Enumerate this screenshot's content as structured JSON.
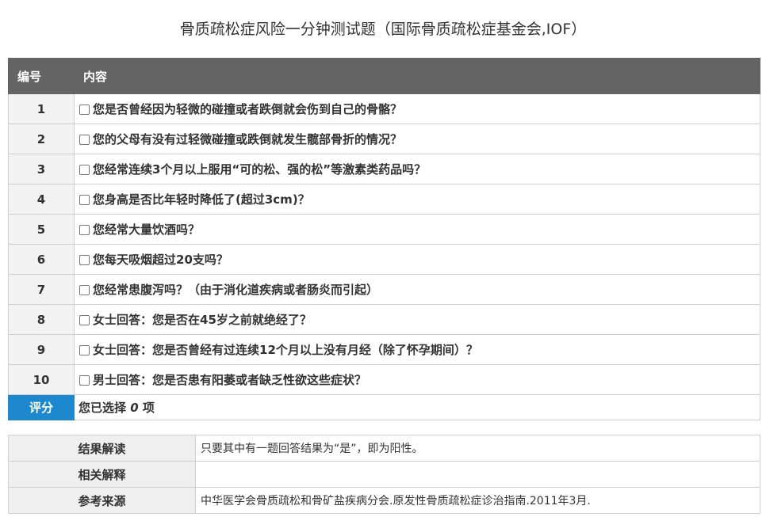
{
  "page": {
    "title": "骨质疏松症风险一分钟测试题（国际骨质疏松症基金会,IOF）"
  },
  "quiz": {
    "headers": {
      "number": "编号",
      "content": "内容"
    },
    "questions": [
      {
        "number": "1",
        "text": "您是否曾经因为轻微的碰撞或者跌倒就会伤到自己的骨骼？",
        "checked": false
      },
      {
        "number": "2",
        "text": "您的父母有没有过轻微碰撞或跌倒就发生髋部骨折的情况？",
        "checked": false
      },
      {
        "number": "3",
        "text": "您经常连续3个月以上服用“可的松、强的松”等激素类药品吗？",
        "checked": false
      },
      {
        "number": "4",
        "text": "您身高是否比年轻时降低了(超过3cm)？",
        "checked": false
      },
      {
        "number": "5",
        "text": "您经常大量饮酒吗？",
        "checked": false
      },
      {
        "number": "6",
        "text": "您每天吸烟超过20支吗？",
        "checked": false
      },
      {
        "number": "7",
        "text": "您经常患腹泻吗？（由于消化道疾病或者肠炎而引起）",
        "checked": false
      },
      {
        "number": "8",
        "text": "女士回答：您是否在45岁之前就绝经了？",
        "checked": false
      },
      {
        "number": "9",
        "text": "女士回答：您是否曾经有过连续12个月以上没有月经（除了怀孕期间）？",
        "checked": false
      },
      {
        "number": "10",
        "text": "男士回答：您是否患有阳萎或者缺乏性欲这些症状？",
        "checked": false
      }
    ],
    "score": {
      "label": "评分",
      "prefix": "您已选择 ",
      "count": "0",
      "suffix": " 项"
    }
  },
  "info": {
    "result_label": "结果解读",
    "result_value": "只要其中有一题回答结果为“是”，即为阳性。",
    "related_label": "相关解释",
    "related_value": "",
    "source_label": "参考来源",
    "source_value": "中华医学会骨质疏松和骨矿盐疾病分会.原发性骨质疏松症诊治指南.2011年3月."
  },
  "colors": {
    "header_bg": "#646464",
    "score_bg": "#1e88cf",
    "cell_border": "#cfcfcf",
    "number_bg": "#f2f2f2"
  }
}
